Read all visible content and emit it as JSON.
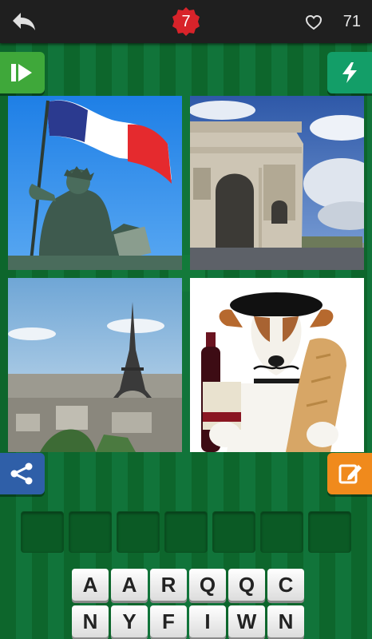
{
  "header": {
    "back_icon": "back-arrow-icon",
    "level": "7",
    "coin_icon": "heart-coin-icon",
    "coins": "71"
  },
  "buttons": {
    "skip_icon": "skip-icon",
    "bolt_icon": "lightning-icon",
    "share_icon": "share-icon",
    "edit_icon": "edit-icon"
  },
  "pictures": [
    {
      "name": "statue-with-flag-picture"
    },
    {
      "name": "arc-de-triomphe-picture"
    },
    {
      "name": "eiffel-tower-picture"
    },
    {
      "name": "dog-with-beret-picture"
    }
  ],
  "answer_slots": 7,
  "letters_row1": [
    "A",
    "A",
    "R",
    "Q",
    "Q",
    "C"
  ],
  "letters_row2": [
    "N",
    "Y",
    "F",
    "I",
    "W",
    "N"
  ],
  "colors": {
    "background": "#0e6b2e",
    "level_badge": "#d8232a",
    "skip": "#3fa83a",
    "bolt": "#139e68",
    "share": "#2f5fa8",
    "edit": "#f08a1c"
  }
}
